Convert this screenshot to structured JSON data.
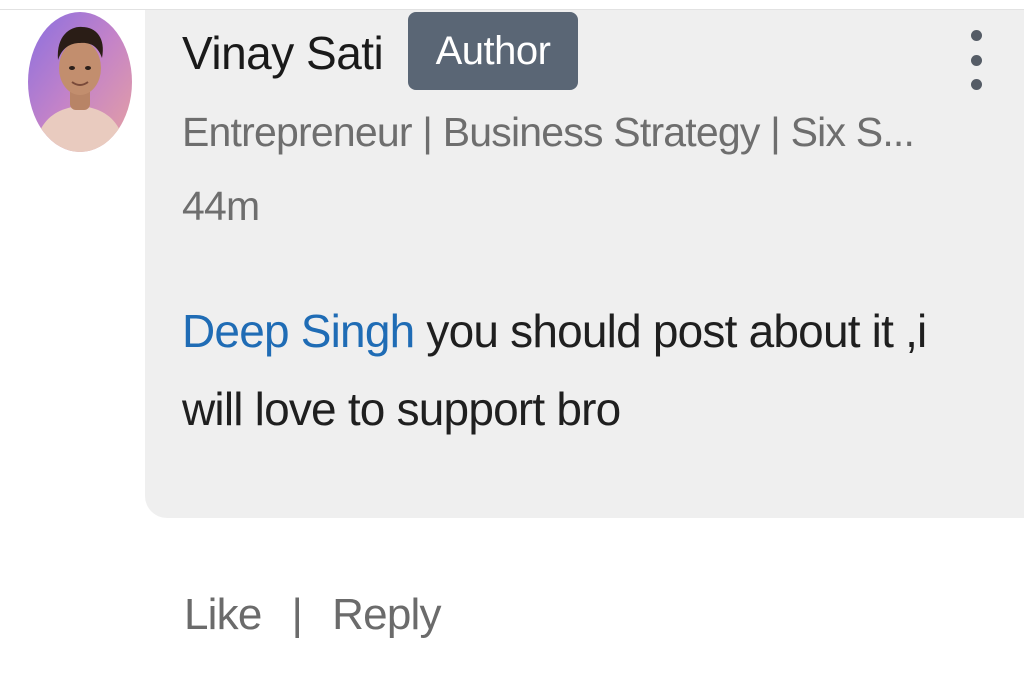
{
  "comment": {
    "author": {
      "name": "Vinay Sati",
      "badge": "Author",
      "headline": "Entrepreneur | Business Strategy | Six S...",
      "avatar_icon": "profile-photo"
    },
    "timestamp": "44m",
    "mention": "Deep Singh",
    "text": " you should post about it  ,i will love to support  bro",
    "more_icon": "vertical-ellipsis-icon"
  },
  "actions": {
    "like_label": "Like",
    "separator": "|",
    "reply_label": "Reply"
  },
  "colors": {
    "bubble_bg": "#efefef",
    "badge_bg": "#5a6675",
    "mention": "#1f6cb5",
    "secondary_text": "#6e6e6e"
  }
}
